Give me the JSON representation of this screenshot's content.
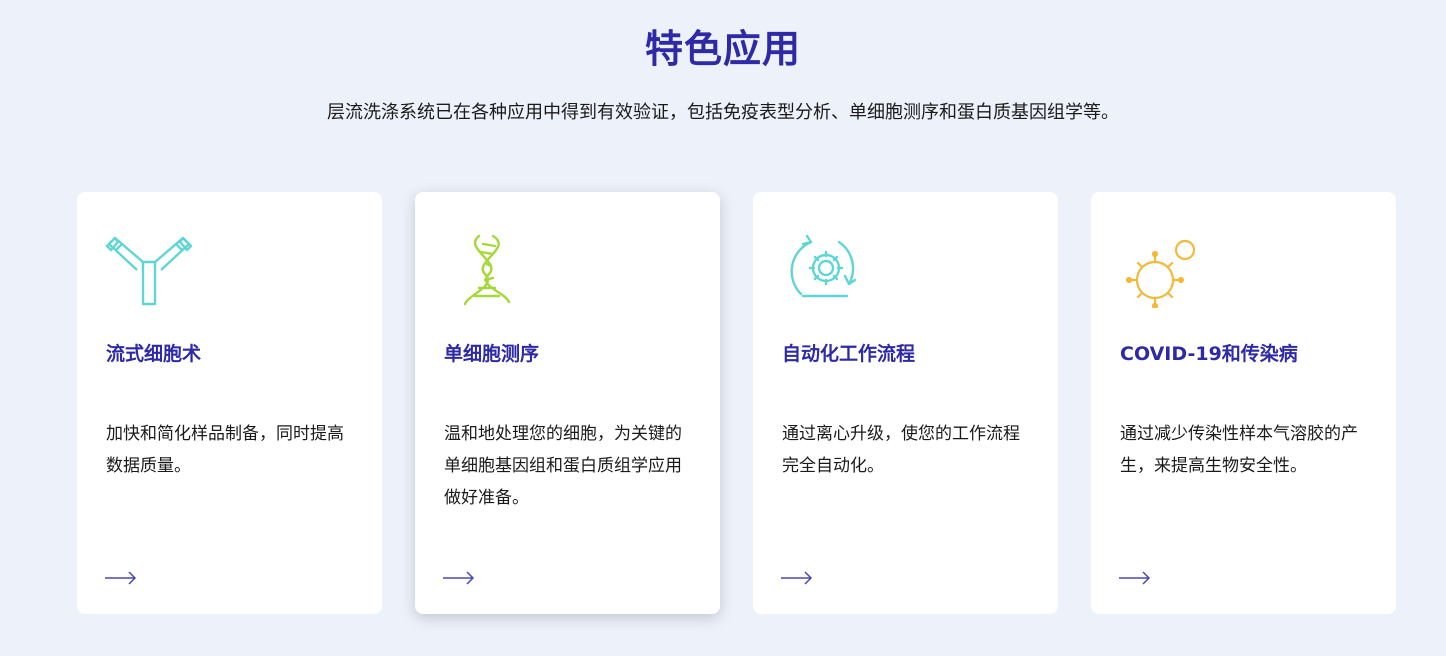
{
  "header": {
    "title": "特色应用",
    "subtitle": "层流洗涤系统已在各种应用中得到有效验证，包括免疫表型分析、单细胞测序和蛋白质基因组学等。"
  },
  "cards": [
    {
      "title": "流式细胞术",
      "description": "加快和简化样品制备，同时提高数据质量。",
      "icon": "antibody-icon",
      "icon_color": "#5fd6d4"
    },
    {
      "title": "单细胞测序",
      "description": "温和地处理您的细胞，为关键的单细胞基因组和蛋白质组学应用做好准备。",
      "icon": "dna-icon",
      "icon_color": "#a6d83a"
    },
    {
      "title": "自动化工作流程",
      "description": "通过离心升级，使您的工作流程完全自动化。",
      "icon": "gear-cycle-icon",
      "icon_color": "#5fd6d4"
    },
    {
      "title": "COVID-19和传染病",
      "description": "通过减少传染性样本气溶胶的产生，来提高生物安全性。",
      "icon": "virus-icon",
      "icon_color": "#f5b83a"
    }
  ],
  "colors": {
    "accent": "#2e2aa5",
    "background": "#edf1f9",
    "card": "#ffffff",
    "arrow": "#4b47b8"
  }
}
